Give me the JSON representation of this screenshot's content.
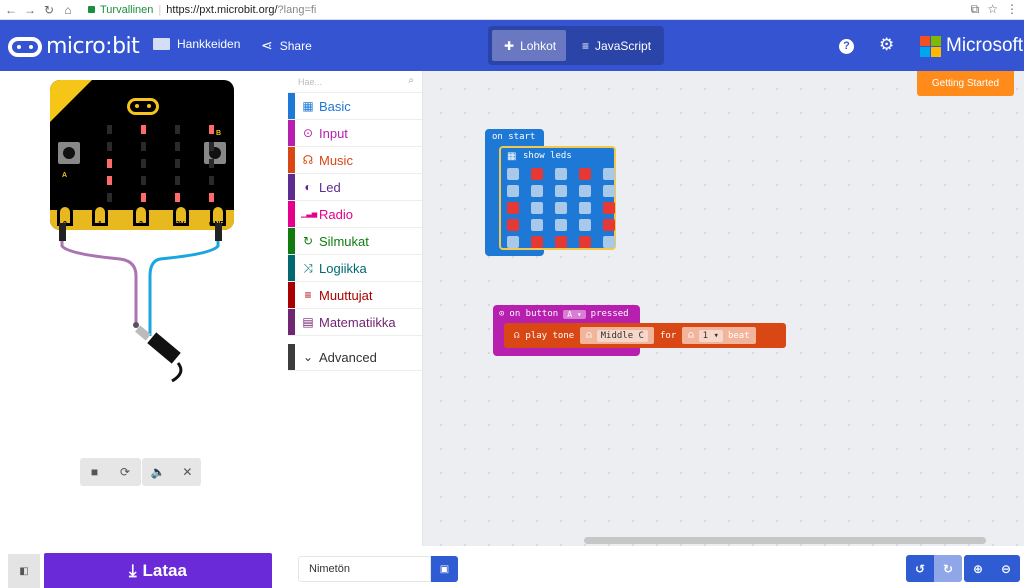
{
  "browser": {
    "secure_label": "Turvallinen",
    "url_host": "https://pxt.microbit.org/",
    "url_rest": "?lang=fi"
  },
  "header": {
    "logo": "micro:bit",
    "projects_label": "Hankkeiden",
    "share_label": "Share",
    "tabs": [
      {
        "label": "Lohkot",
        "active": true
      },
      {
        "label": "JavaScript",
        "active": false
      }
    ],
    "brand": "Microsoft",
    "brand_colors": [
      "#f25022",
      "#7fba00",
      "#00a4ef",
      "#ffb900"
    ],
    "accent": "#3454d1"
  },
  "simulator": {
    "pins": [
      "0",
      "1",
      "2",
      "3V",
      "GND"
    ],
    "button_a": "A",
    "button_b": "B",
    "led_matrix": [
      [
        0,
        1,
        0,
        1,
        0
      ],
      [
        0,
        0,
        0,
        0,
        0
      ],
      [
        1,
        0,
        0,
        0,
        1
      ],
      [
        1,
        0,
        0,
        0,
        1
      ],
      [
        0,
        1,
        1,
        1,
        0
      ]
    ]
  },
  "toolbox": {
    "search_placeholder": "Hae...",
    "categories": [
      {
        "label": "Basic",
        "color": "#1e78d6",
        "icon": "grid-icon"
      },
      {
        "label": "Input",
        "color": "#b71fae",
        "icon": "target-icon"
      },
      {
        "label": "Music",
        "color": "#d94715",
        "icon": "headphones-icon"
      },
      {
        "label": "Led",
        "color": "#5c2d91",
        "icon": "toggle-icon"
      },
      {
        "label": "Radio",
        "color": "#e3008c",
        "icon": "signal-icon"
      },
      {
        "label": "Silmukat",
        "color": "#107c10",
        "icon": "loop-icon"
      },
      {
        "label": "Logiikka",
        "color": "#006970",
        "icon": "shuffle-icon"
      },
      {
        "label": "Muuttujat",
        "color": "#a80000",
        "icon": "lines-icon"
      },
      {
        "label": "Matematiikka",
        "color": "#712672",
        "icon": "calculator-icon"
      }
    ],
    "advanced": "Advanced"
  },
  "workspace": {
    "getting_started": "Getting Started",
    "on_start": "on start",
    "show_leds": "show leds",
    "show_leds_matrix": [
      [
        0,
        1,
        0,
        1,
        0
      ],
      [
        0,
        0,
        0,
        0,
        0
      ],
      [
        1,
        0,
        0,
        0,
        1
      ],
      [
        1,
        0,
        0,
        0,
        1
      ],
      [
        0,
        1,
        1,
        1,
        0
      ]
    ],
    "on_button": "on button",
    "button_value": "A",
    "pressed": "pressed",
    "play_tone": "play tone",
    "note": "Middle C",
    "for": "for",
    "beat_value": "1",
    "beat": "beat"
  },
  "footer": {
    "download_label": "Lataa",
    "project_name": "Nimetön"
  }
}
